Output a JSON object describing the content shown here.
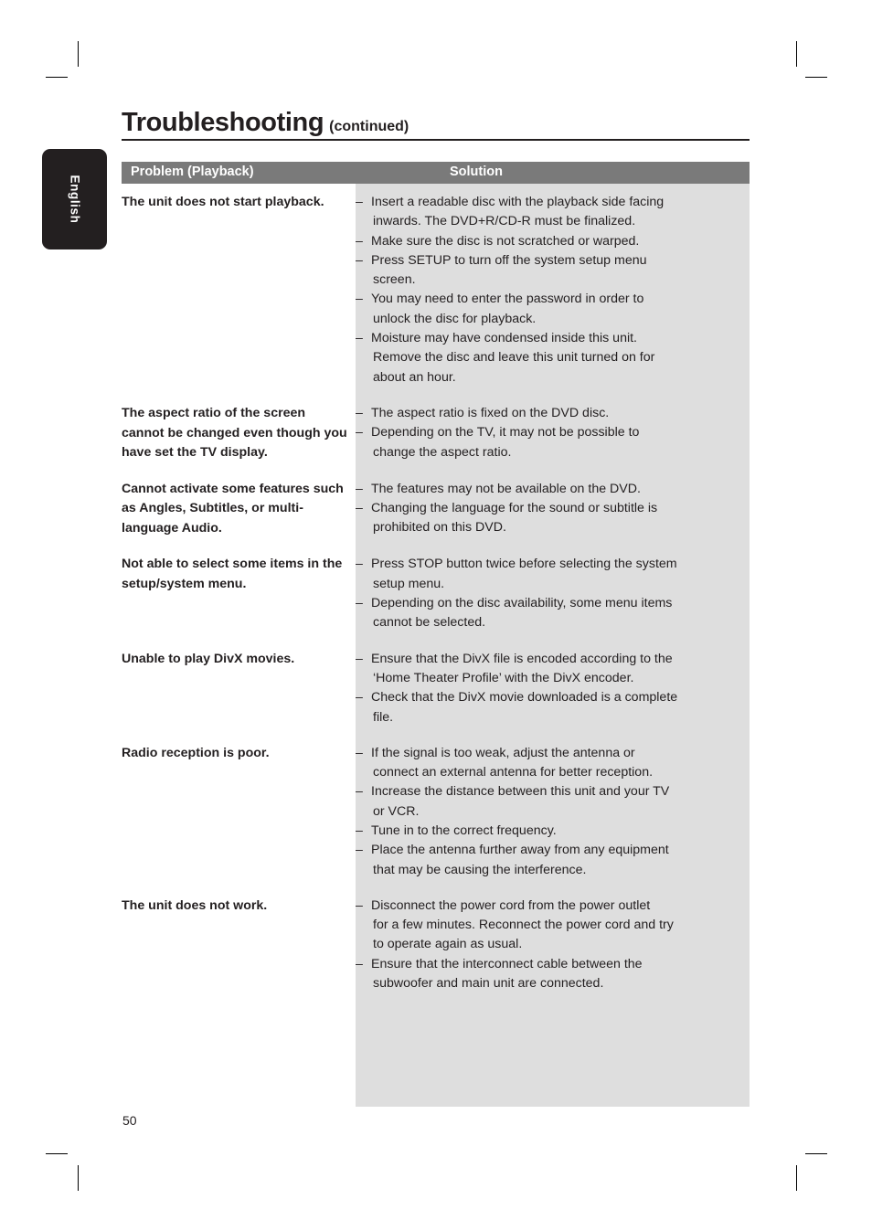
{
  "language_tab": {
    "label": "English"
  },
  "title": {
    "main": "Troubleshooting",
    "continued": "(continued)"
  },
  "table": {
    "headers": {
      "problem": "Problem (Playback)",
      "solution": "Solution"
    },
    "rows": [
      {
        "problem": "The unit does not start playback.",
        "solutions": [
          {
            "line1": "Insert a readable disc with the playback side facing",
            "line2": "inwards. The DVD+R/CD-R must be finalized."
          },
          {
            "line1": "Make sure the disc is not scratched or warped."
          },
          {
            "line1": "Press SETUP to turn off the system setup menu",
            "line2": "screen."
          },
          {
            "line1": "You may need to enter the password in order to",
            "line2": "unlock the disc for playback."
          },
          {
            "line1": "Moisture may have condensed inside this unit.",
            "line2": "Remove the disc and leave this unit turned on for",
            "line3": "about an hour."
          }
        ]
      },
      {
        "problem": "The aspect ratio of the screen cannot be changed even though you have set the TV display.",
        "solutions": [
          {
            "line1": "The aspect ratio is fixed on the DVD disc."
          },
          {
            "line1": "Depending on the TV, it may not be possible to",
            "line2": "change the aspect ratio."
          }
        ]
      },
      {
        "problem": "Cannot activate some features such as Angles, Subtitles, or multi-language Audio.",
        "solutions": [
          {
            "line1": "The features may not be available on the DVD."
          },
          {
            "line1": "Changing the language for the sound or subtitle is",
            "line2": "prohibited on this DVD."
          }
        ]
      },
      {
        "problem": "Not able to select some items in the setup/system menu.",
        "solutions": [
          {
            "line1": "Press STOP button twice before selecting the system",
            "line2": "setup menu."
          },
          {
            "line1": "Depending on the disc availability, some menu items",
            "line2": "cannot be selected."
          }
        ]
      },
      {
        "problem": "Unable to play DivX movies.",
        "solutions": [
          {
            "line1": "Ensure that the DivX file is encoded according to the",
            "line2": "‘Home Theater Profile’ with the DivX encoder."
          },
          {
            "line1": "Check that the DivX movie downloaded is a complete",
            "line2": "file."
          }
        ]
      },
      {
        "problem": "Radio reception is poor.",
        "solutions": [
          {
            "line1": "If the signal is too weak, adjust the antenna or",
            "line2": "connect an external antenna for better reception."
          },
          {
            "line1": "Increase the distance between this unit and your TV",
            "line2": "or VCR."
          },
          {
            "line1": "Tune in to the correct frequency."
          },
          {
            "line1": "Place the antenna further away from any equipment",
            "line2": "that may be causing the interference."
          }
        ]
      },
      {
        "problem": "The unit does not work.",
        "solutions": [
          {
            "line1": "Disconnect the power cord from the power outlet",
            "line2": "for a few minutes. Reconnect the power cord and try",
            "line3": "to operate again as usual."
          },
          {
            "line1": "Ensure that the interconnect cable between the",
            "line2": "subwoofer and main unit are connected."
          }
        ]
      }
    ],
    "bullet_glyph": "–"
  },
  "page_number": "50",
  "colors": {
    "header_bar": "#7a7a7a",
    "solution_column": "#dedede",
    "tab": "#231f20",
    "text": "#231f20"
  }
}
